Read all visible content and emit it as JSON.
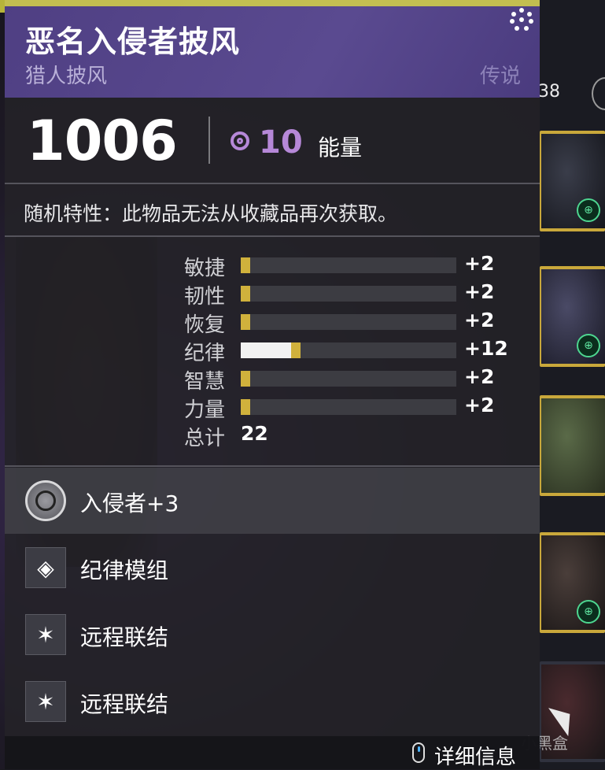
{
  "item": {
    "name": "恶名入侵者披风",
    "type": "猎人披风",
    "rarity": "传说"
  },
  "power": {
    "value": "1006",
    "energy": "10",
    "energy_label": "能量"
  },
  "note": "随机特性：此物品无法从收藏品再次获取。",
  "stats": [
    {
      "label": "敏捷",
      "value": "+2",
      "fraction": 0.02,
      "base_fraction": 0.0
    },
    {
      "label": "韧性",
      "value": "+2",
      "fraction": 0.02,
      "base_fraction": 0.0
    },
    {
      "label": "恢复",
      "value": "+2",
      "fraction": 0.02,
      "base_fraction": 0.0
    },
    {
      "label": "纪律",
      "value": "+12",
      "fraction": 0.12,
      "base_fraction": 0.1
    },
    {
      "label": "智慧",
      "value": "+2",
      "fraction": 0.02,
      "base_fraction": 0.0
    },
    {
      "label": "力量",
      "value": "+2",
      "fraction": 0.02,
      "base_fraction": 0.0
    }
  ],
  "total": {
    "label": "总计",
    "value": "22"
  },
  "perks": [
    {
      "label": "入侵者+3",
      "icon": "intrinsic-perk-icon",
      "highlighted": true
    },
    {
      "label": "纪律模组",
      "icon": "discipline-mod-icon",
      "highlighted": false
    },
    {
      "label": "远程联结",
      "icon": "distance-connection-icon",
      "highlighted": false
    },
    {
      "label": "远程联结",
      "icon": "distance-connection-icon",
      "highlighted": false
    }
  ],
  "footer": {
    "detail_label": "详细信息"
  },
  "inventory": {
    "count_text": "38"
  },
  "watermark": "小黑盒",
  "colors": {
    "header_purple": "#55468a",
    "energy_purple": "#b688d8",
    "stat_gold": "#d0b13c",
    "mod_green": "#4dd690"
  }
}
